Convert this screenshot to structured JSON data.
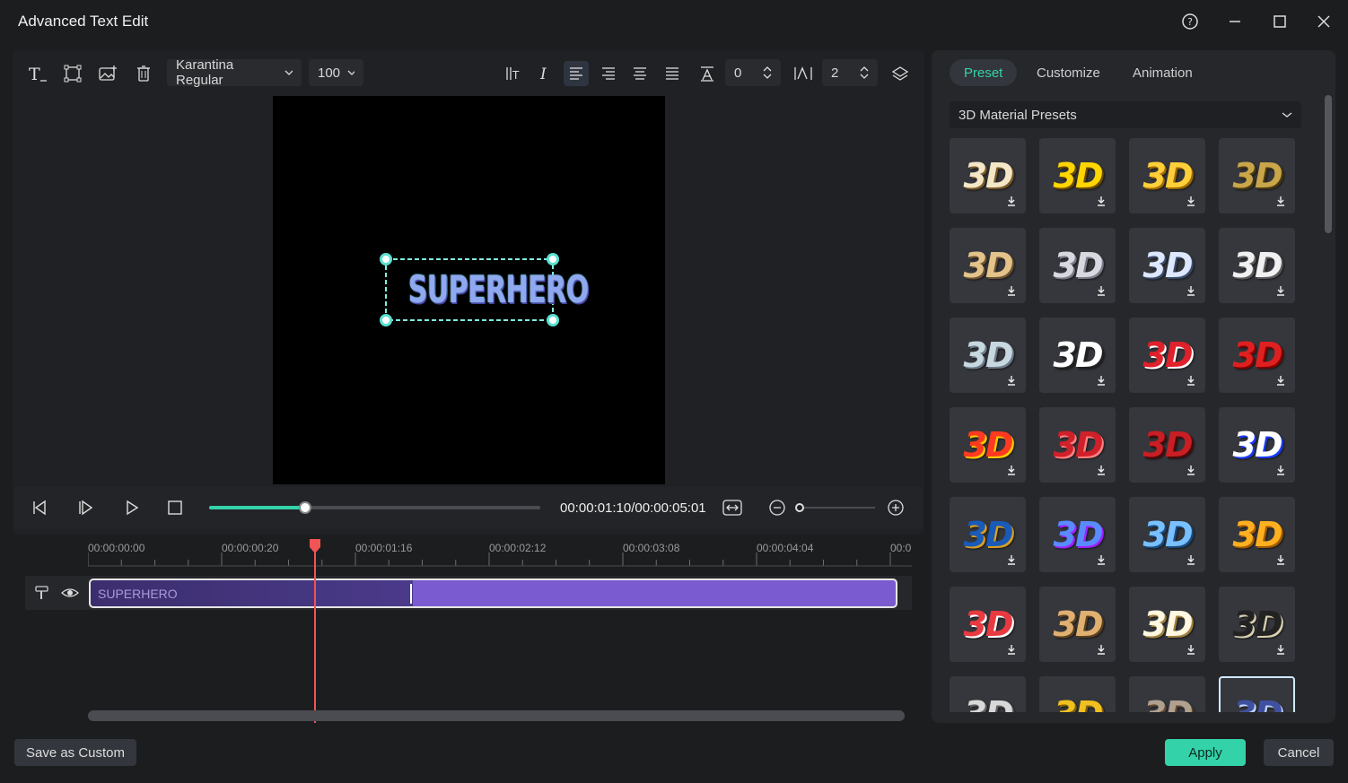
{
  "window": {
    "title": "Advanced Text Edit"
  },
  "toolbar": {
    "font": "Karantina Regular",
    "font_size": "100",
    "char_spacing": "0",
    "line_spacing": "2"
  },
  "preview": {
    "text": "SUPERHERO"
  },
  "player": {
    "time": "00:00:01:10/00:00:05:01",
    "progress": 0.29
  },
  "timeline": {
    "ticks": [
      "00:00:00:00",
      "00:00:00:20",
      "00:00:01:16",
      "00:00:02:12",
      "00:00:03:08",
      "00:00:04:04",
      "00:0"
    ],
    "clip_label": "SUPERHERO"
  },
  "right_panel": {
    "tabs": [
      "Preset",
      "Customize",
      "Animation"
    ],
    "active_tab": "Preset",
    "preset_category": "3D Material Presets",
    "tile_label": "3D"
  },
  "footer": {
    "save_custom": "Save as Custom",
    "apply": "Apply",
    "cancel": "Cancel"
  },
  "colors": {
    "accent": "#34d2a8",
    "clip": "#7a5bd0",
    "playhead": "#f05454"
  }
}
